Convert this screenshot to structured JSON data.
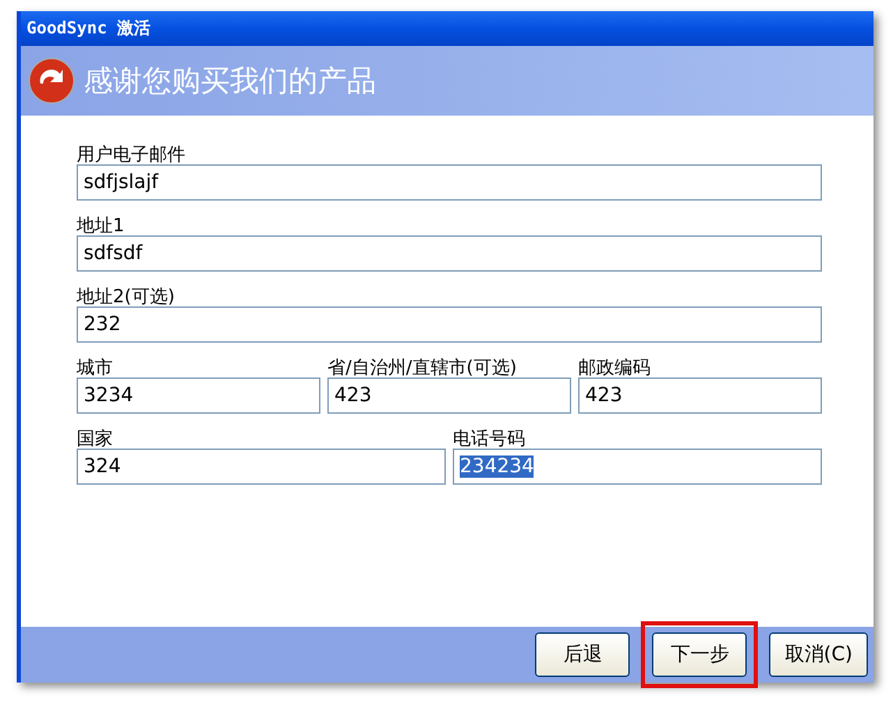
{
  "window": {
    "title": "GoodSync 激活"
  },
  "header": {
    "title": "感谢您购买我们的产品"
  },
  "form_rows": [
    {
      "fields": [
        {
          "label": "用户电子邮件",
          "value": "sdfjslajf",
          "selected": false
        }
      ]
    },
    {
      "fields": [
        {
          "label": "地址1",
          "value": "sdfsdf",
          "selected": false
        }
      ]
    },
    {
      "fields": [
        {
          "label": "地址2(可选)",
          "value": "232",
          "selected": false
        }
      ]
    },
    {
      "fields": [
        {
          "label": "城市",
          "value": "3234",
          "selected": false
        },
        {
          "label": "省/自治州/直辖市(可选)",
          "value": "423",
          "selected": false
        },
        {
          "label": "邮政编码",
          "value": "423",
          "selected": false
        }
      ]
    },
    {
      "fields": [
        {
          "label": "国家",
          "value": "324",
          "selected": false
        },
        {
          "label": "电话号码",
          "value": "234234",
          "selected": true
        }
      ]
    }
  ],
  "buttons": [
    {
      "label": "后退",
      "highlighted": false
    },
    {
      "label": "下一步",
      "highlighted": true
    },
    {
      "label": "取消(C)",
      "highlighted": false
    }
  ]
}
